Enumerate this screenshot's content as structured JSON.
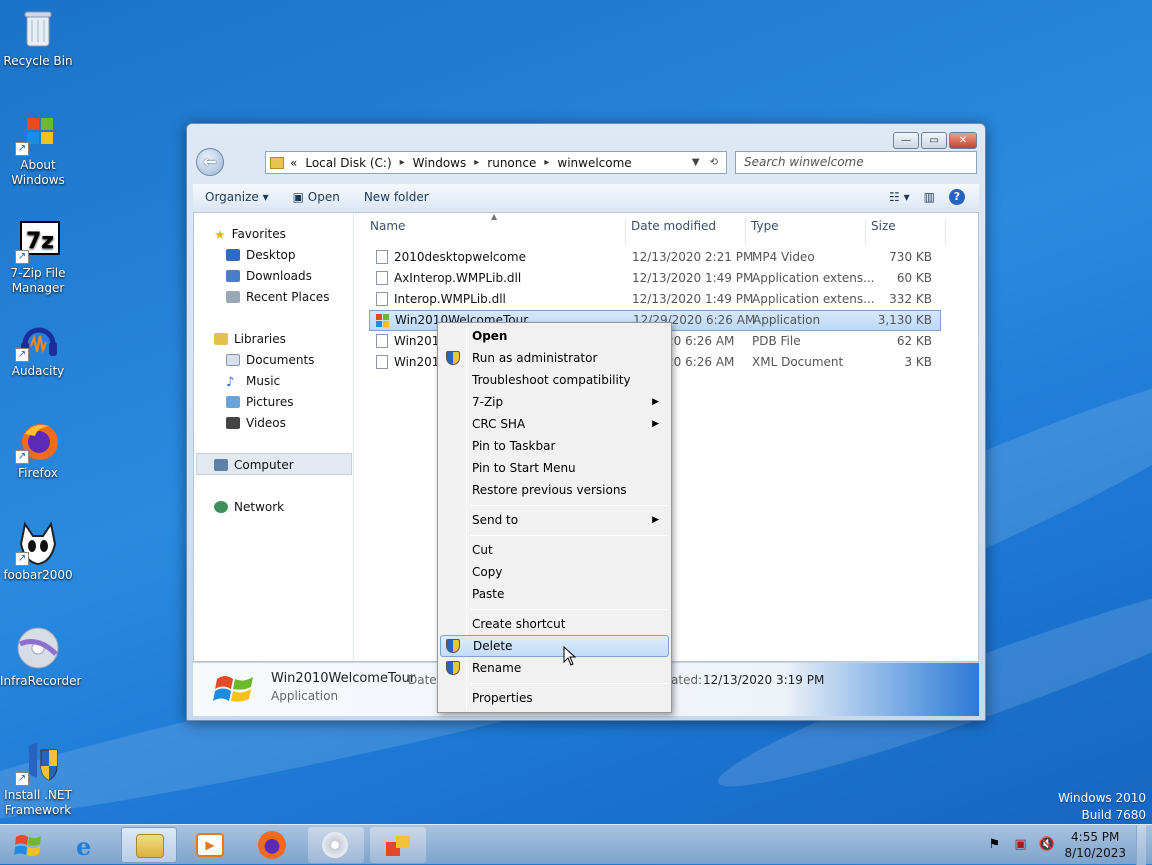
{
  "desktop": {
    "icons": [
      {
        "label": "Recycle Bin",
        "icon": "recycle-bin-icon",
        "shortcut": false
      },
      {
        "label": "About Windows",
        "icon": "windows-logo-icon",
        "shortcut": true
      },
      {
        "label": "7-Zip File Manager",
        "icon": "7zip-icon",
        "shortcut": true
      },
      {
        "label": "Audacity",
        "icon": "audacity-icon",
        "shortcut": true
      },
      {
        "label": "Firefox",
        "icon": "firefox-icon",
        "shortcut": true
      },
      {
        "label": "foobar2000",
        "icon": "foobar2000-icon",
        "shortcut": true
      },
      {
        "label": "InfraRecorder",
        "icon": "infrarecorder-icon",
        "shortcut": false
      },
      {
        "label": "Install .NET Framework",
        "icon": "dotnet-shield-icon",
        "shortcut": true
      }
    ],
    "watermark": {
      "line1": "Windows 2010",
      "line2": "Build 7680"
    }
  },
  "explorer": {
    "address": {
      "prefix": "«",
      "crumbs": [
        "Local Disk (C:)",
        "Windows",
        "runonce",
        "winwelcome"
      ],
      "sep": "▸"
    },
    "search_placeholder": "Search winwelcome",
    "toolbar": {
      "organize": "Organize ▾",
      "open": "Open",
      "new_folder": "New folder"
    },
    "nav": {
      "favorites": "Favorites",
      "desktop": "Desktop",
      "downloads": "Downloads",
      "recent": "Recent Places",
      "libraries": "Libraries",
      "documents": "Documents",
      "music": "Music",
      "pictures": "Pictures",
      "videos": "Videos",
      "computer": "Computer",
      "network": "Network"
    },
    "columns": {
      "name": "Name",
      "date": "Date modified",
      "type": "Type",
      "size": "Size"
    },
    "files": [
      {
        "name": "2010desktopwelcome",
        "date": "12/13/2020 2:21 PM",
        "type": "MP4 Video",
        "size": "730 KB"
      },
      {
        "name": "AxInterop.WMPLib.dll",
        "date": "12/13/2020 1:49 PM",
        "type": "Application extens...",
        "size": "60 KB"
      },
      {
        "name": "Interop.WMPLib.dll",
        "date": "12/13/2020 1:49 PM",
        "type": "Application extens...",
        "size": "332 KB"
      },
      {
        "name": "Win2010WelcomeTour",
        "date": "12/29/2020 6:26 AM",
        "type": "Application",
        "size": "3,130 KB"
      },
      {
        "name": "Win2010",
        "date": "20 6:26 AM",
        "type": "PDB File",
        "size": "62 KB"
      },
      {
        "name": "Win2010",
        "date": "20 6:26 AM",
        "type": "XML Document",
        "size": "3 KB"
      }
    ],
    "details": {
      "name": "Win2010WelcomeTour",
      "kind": "Application",
      "date_label": "Date",
      "created_label": "ated:",
      "created_value": "12/13/2020 3:19 PM"
    }
  },
  "context_menu": {
    "items": {
      "open": "Open",
      "run_admin": "Run as administrator",
      "troubleshoot": "Troubleshoot compatibility",
      "zip": "7-Zip",
      "crc": "CRC SHA",
      "pin_taskbar": "Pin to Taskbar",
      "pin_start": "Pin to Start Menu",
      "restore": "Restore previous versions",
      "send_to": "Send to",
      "cut": "Cut",
      "copy": "Copy",
      "paste": "Paste",
      "create_shortcut": "Create shortcut",
      "delete": "Delete",
      "rename": "Rename",
      "properties": "Properties"
    },
    "submenu_arrow": "▶"
  },
  "taskbar": {
    "clock_time": "4:55 PM",
    "clock_date": "8/10/2023"
  }
}
